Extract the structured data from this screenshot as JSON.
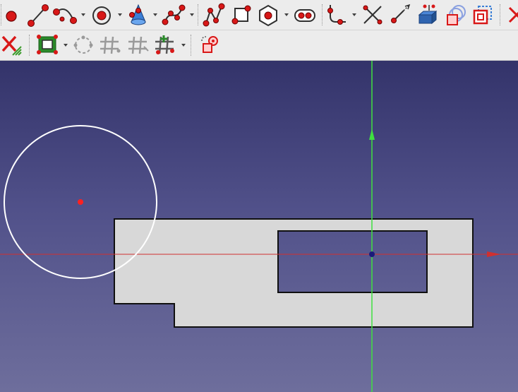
{
  "toolbar_row1": {
    "items": [
      {
        "name": "point-icon"
      },
      {
        "name": "line-icon"
      },
      {
        "name": "arc-icon",
        "dropdown": true
      },
      {
        "name": "circle-icon",
        "dropdown": true
      },
      {
        "name": "conic-icon",
        "dropdown": true
      },
      {
        "name": "bspline-icon",
        "dropdown": true
      },
      {
        "name": "polyline-icon"
      },
      {
        "name": "rectangle-icon"
      },
      {
        "name": "polygon-icon",
        "dropdown": true
      },
      {
        "name": "slot-icon"
      },
      {
        "name": "fillet-icon",
        "dropdown": true
      },
      {
        "name": "trim-icon"
      },
      {
        "name": "extend-icon"
      },
      {
        "name": "external-geometry-icon"
      },
      {
        "name": "carbon-copy-icon"
      },
      {
        "name": "construction-mode-icon"
      },
      {
        "name": "close-overflow-icon"
      }
    ]
  },
  "toolbar_row2": {
    "items": [
      {
        "name": "delete-constraints-icon"
      },
      {
        "name": "select-elements-icon",
        "dropdown": true
      },
      {
        "name": "show-hide-geometry-icon"
      },
      {
        "name": "grid-snap-icon"
      },
      {
        "name": "grid-constrained-icon"
      },
      {
        "name": "rectangular-array-icon",
        "dropdown": true
      },
      {
        "name": "restore-internal-geometry-icon"
      }
    ]
  },
  "viewport": {
    "background_top": "#33336a",
    "background_bottom": "#6e6e9c",
    "colors": {
      "axis_x": "#d03030",
      "axis_y": "#40e040",
      "edge": "#101010",
      "face_fill": "#d8d8d8",
      "selected_circle": "#ffffff",
      "circle_center": "#ff2020",
      "origin": "#1a1a7a"
    }
  }
}
